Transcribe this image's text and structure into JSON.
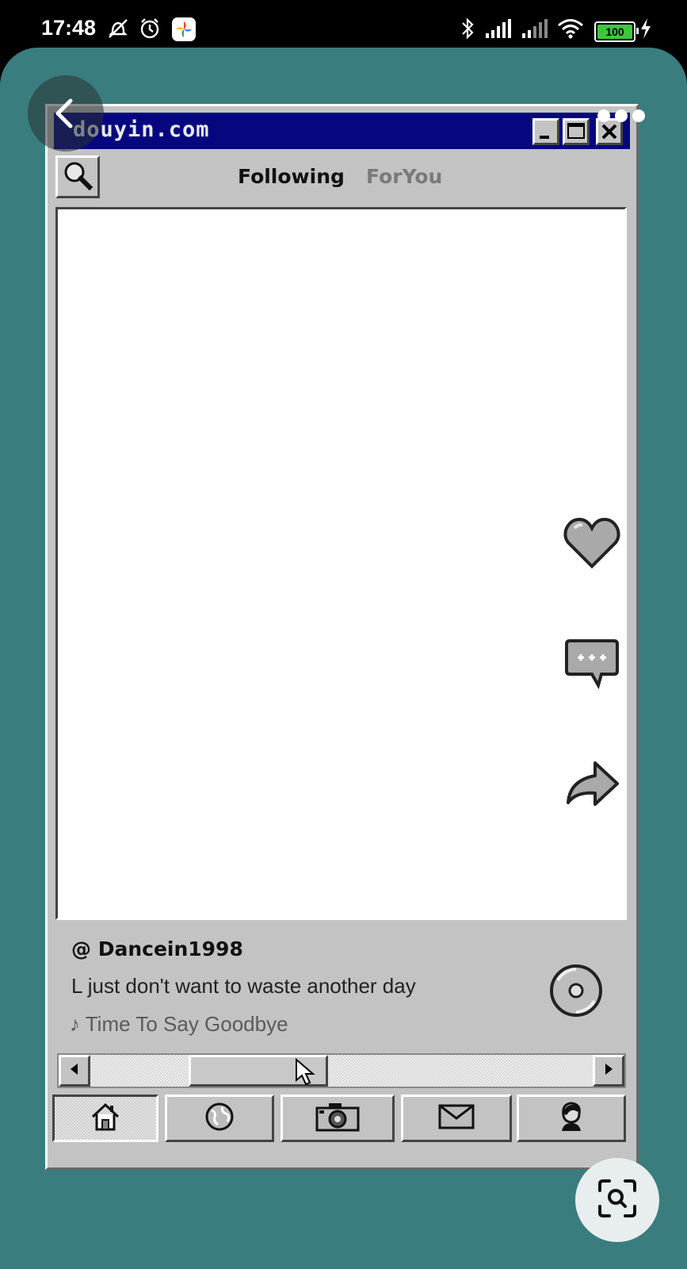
{
  "status_bar": {
    "time": "17:48",
    "battery": "100"
  },
  "window": {
    "title": "douyin.com"
  },
  "tabs": [
    {
      "label": "Following",
      "active": true
    },
    {
      "label": "ForYou",
      "active": false
    }
  ],
  "post": {
    "handle": "@ Dancein1998",
    "caption": "L just don't want to waste another day",
    "song": "Time To Say Goodbye",
    "song_icon": "♪"
  },
  "side_actions": [
    "heart-icon",
    "comment-icon",
    "share-icon"
  ],
  "nav_items": [
    "home-icon",
    "globe-icon",
    "camera-icon",
    "mail-icon",
    "profile-icon"
  ],
  "colors": {
    "viewer_bg": "#3a7d7f",
    "titlebar": "#06067f",
    "window_gray": "#c3c3c3"
  }
}
